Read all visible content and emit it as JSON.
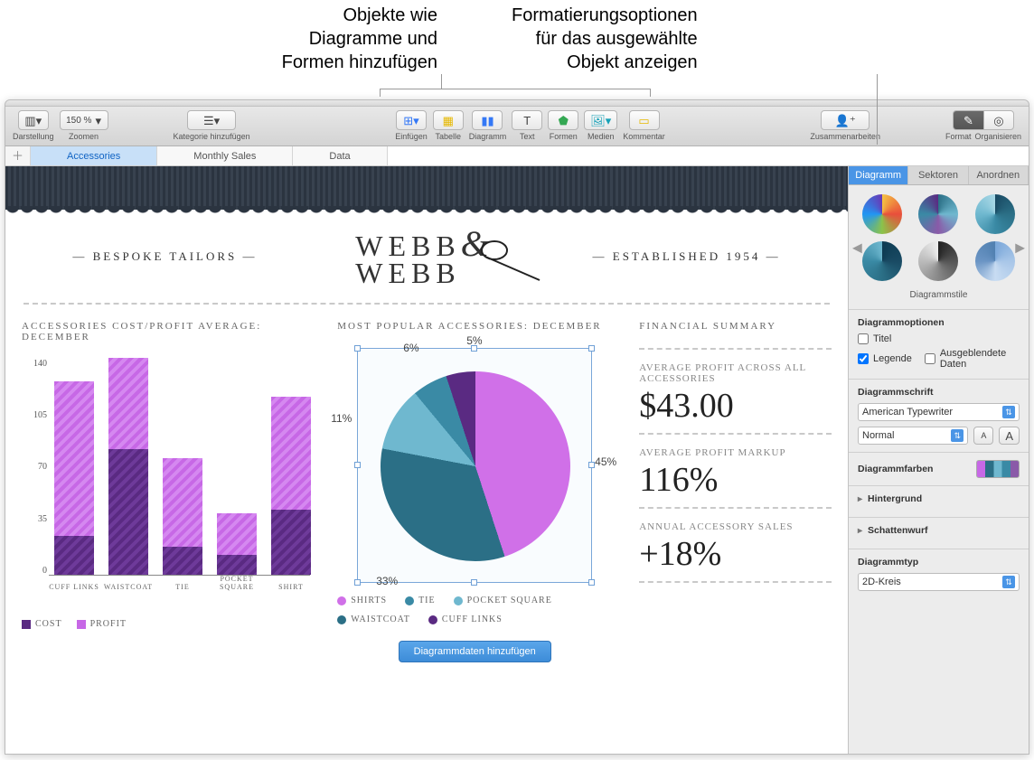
{
  "annotations": {
    "left": "Objekte wie\nDiagramme und\nFormen hinzufügen",
    "right": "Formatierungsoptionen\nfür das ausgewählte\nObjekt anzeigen"
  },
  "toolbar": {
    "view_label": "Darstellung",
    "zoom_value": "150 %",
    "zoom_label": "Zoomen",
    "category_label": "Kategorie hinzufügen",
    "insert": "Einfügen",
    "table": "Tabelle",
    "chart": "Diagramm",
    "text": "Text",
    "shapes": "Formen",
    "media": "Medien",
    "comment": "Kommentar",
    "collab": "Zusammenarbeiten",
    "format": "Format",
    "organize": "Organisieren"
  },
  "tabs": [
    "Accessories",
    "Monthly Sales",
    "Data"
  ],
  "hero": {
    "left": "— BESPOKE TAILORS —",
    "brand1": "WEBB",
    "brand2": "WEBB",
    "right": "— ESTABLISHED 1954 —"
  },
  "bar": {
    "title": "ACCESSORIES COST/PROFIT AVERAGE: DECEMBER",
    "yticks": [
      "140",
      "105",
      "70",
      "35",
      "0"
    ],
    "categories": [
      "CUFF LINKS",
      "WAISTCOAT",
      "TIE",
      "POCKET SQUARE",
      "SHIRT"
    ],
    "legend": {
      "a": "COST",
      "b": "PROFIT"
    }
  },
  "pie": {
    "title": "MOST POPULAR ACCESSORIES: DECEMBER",
    "labels": {
      "a": "45%",
      "b": "33%",
      "c": "11%",
      "d": "6%",
      "e": "5%"
    },
    "legend": [
      "SHIRTS",
      "TIE",
      "POCKET SQUARE",
      "WAISTCOAT",
      "CUFF LINKS"
    ],
    "button": "Diagrammdaten hinzufügen"
  },
  "summary": {
    "title": "FINANCIAL SUMMARY",
    "l1": "AVERAGE PROFIT ACROSS ALL ACCESSORIES",
    "v1": "$43.00",
    "l2": "AVERAGE PROFIT MARKUP",
    "v2": "116%",
    "l3": "ANNUAL ACCESSORY SALES",
    "v3": "+18%"
  },
  "inspector": {
    "tabs": {
      "a": "Diagramm",
      "b": "Sektoren",
      "c": "Anordnen"
    },
    "styles_caption": "Diagrammstile",
    "options_hd": "Diagrammoptionen",
    "opt_title": "Titel",
    "opt_legend": "Legende",
    "opt_hidden": "Ausgeblendete Daten",
    "font_hd": "Diagrammschrift",
    "font_family": "American Typewriter",
    "font_style": "Normal",
    "colors_hd": "Diagrammfarben",
    "background": "Hintergrund",
    "shadow": "Schattenwurf",
    "type_hd": "Diagrammtyp",
    "type_value": "2D-Kreis"
  },
  "chart_data": [
    {
      "type": "bar",
      "title": "Accessories Cost/Profit Average: December",
      "categories": [
        "Cuff Links",
        "Waistcoat",
        "Tie",
        "Pocket Square",
        "Shirt"
      ],
      "series": [
        {
          "name": "Cost",
          "values": [
            25,
            81,
            18,
            13,
            42
          ]
        },
        {
          "name": "Profit",
          "values": [
            100,
            59,
            57,
            27,
            73
          ]
        }
      ],
      "ylim": [
        0,
        140
      ],
      "stacked": true
    },
    {
      "type": "pie",
      "title": "Most Popular Accessories: December",
      "series": [
        {
          "name": "Share",
          "values": [
            45,
            33,
            11,
            6,
            5
          ]
        }
      ],
      "categories": [
        "Shirts",
        "Waistcoat",
        "Pocket Square",
        "Tie",
        "Cuff Links"
      ]
    }
  ]
}
